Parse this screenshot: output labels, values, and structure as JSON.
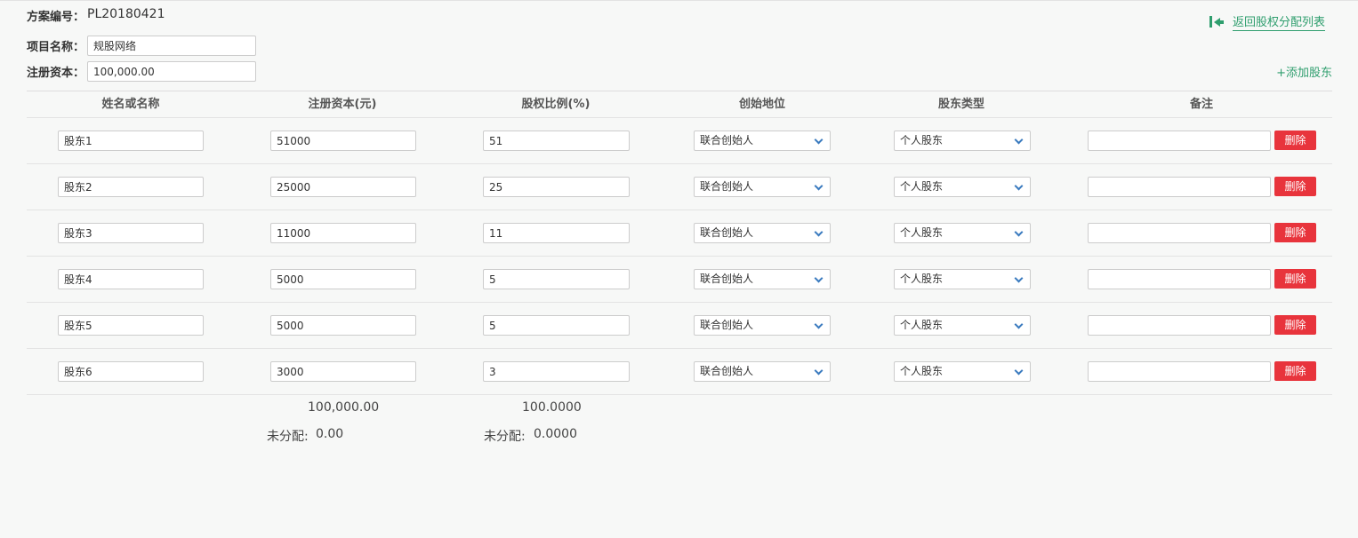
{
  "plan": {
    "number_label": "方案编号：",
    "number_value": "PL20180421"
  },
  "project": {
    "name_label": "项目名称：",
    "name_value": "规股网络",
    "capital_label": "注册资本：",
    "capital_value": "100,000.00"
  },
  "actions": {
    "back_label": "返回股权分配列表",
    "add_label": "+添加股东",
    "delete_label": "删除"
  },
  "table": {
    "headers": [
      "姓名或名称",
      "注册资本(元)",
      "股权比例(%)",
      "创始地位",
      "股东类型",
      "备注"
    ],
    "rows": [
      {
        "name": "股东1",
        "capital": "51000",
        "ratio": "51",
        "role": "联合创始人",
        "type": "个人股东",
        "note": ""
      },
      {
        "name": "股东2",
        "capital": "25000",
        "ratio": "25",
        "role": "联合创始人",
        "type": "个人股东",
        "note": ""
      },
      {
        "name": "股东3",
        "capital": "11000",
        "ratio": "11",
        "role": "联合创始人",
        "type": "个人股东",
        "note": ""
      },
      {
        "name": "股东4",
        "capital": "5000",
        "ratio": "5",
        "role": "联合创始人",
        "type": "个人股东",
        "note": ""
      },
      {
        "name": "股东5",
        "capital": "5000",
        "ratio": "5",
        "role": "联合创始人",
        "type": "个人股东",
        "note": ""
      },
      {
        "name": "股东6",
        "capital": "3000",
        "ratio": "3",
        "role": "联合创始人",
        "type": "个人股东",
        "note": ""
      }
    ]
  },
  "totals": {
    "capital_total": "100,000.00",
    "ratio_total": "100.0000",
    "unallocated_label": "未分配:",
    "capital_unallocated": "0.00",
    "ratio_unallocated": "0.0000"
  },
  "colors": {
    "accent_green": "#2f9e6e",
    "delete_red": "#e8343c",
    "select_chevron": "#3b7bbf"
  },
  "icons": {
    "back": "arrow-left-to-bar-icon",
    "select": "chevron-down-icon"
  }
}
